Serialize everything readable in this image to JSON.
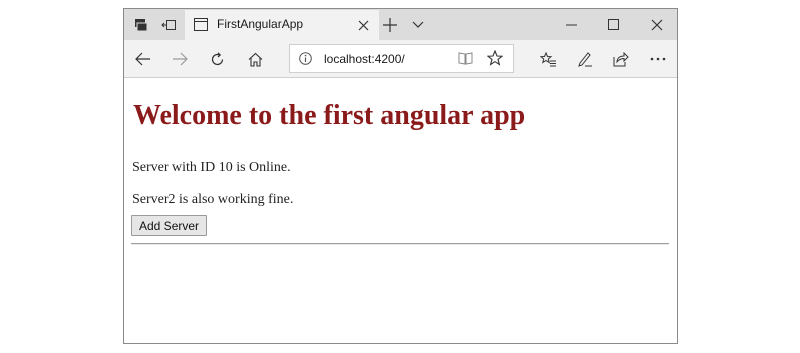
{
  "browser": {
    "tab": {
      "title": "FirstAngularApp"
    },
    "address": {
      "url": "localhost:4200/"
    },
    "icons": {
      "set_aside": "set-aside-tabs-icon",
      "show_tabs": "show-tabs-icon",
      "page": "page-icon",
      "close_tab": "close-icon",
      "new_tab": "plus-icon",
      "tab_preview": "chevron-down-icon",
      "minimize": "minimize-icon",
      "maximize": "maximize-icon",
      "close_window": "close-icon",
      "back": "back-arrow-icon",
      "forward": "forward-arrow-icon",
      "refresh": "refresh-icon",
      "home": "home-icon",
      "site_info": "info-icon",
      "reading_view": "book-icon",
      "favorite": "star-icon",
      "favorites_hub": "favorites-list-icon",
      "notes": "pen-icon",
      "share": "share-icon",
      "more": "more-icon"
    }
  },
  "page": {
    "heading": "Welcome to the first angular app",
    "server_status": "Server with ID 10 is Online.",
    "server2_status": "Server2 is also working fine.",
    "add_server_button": "Add Server"
  }
}
